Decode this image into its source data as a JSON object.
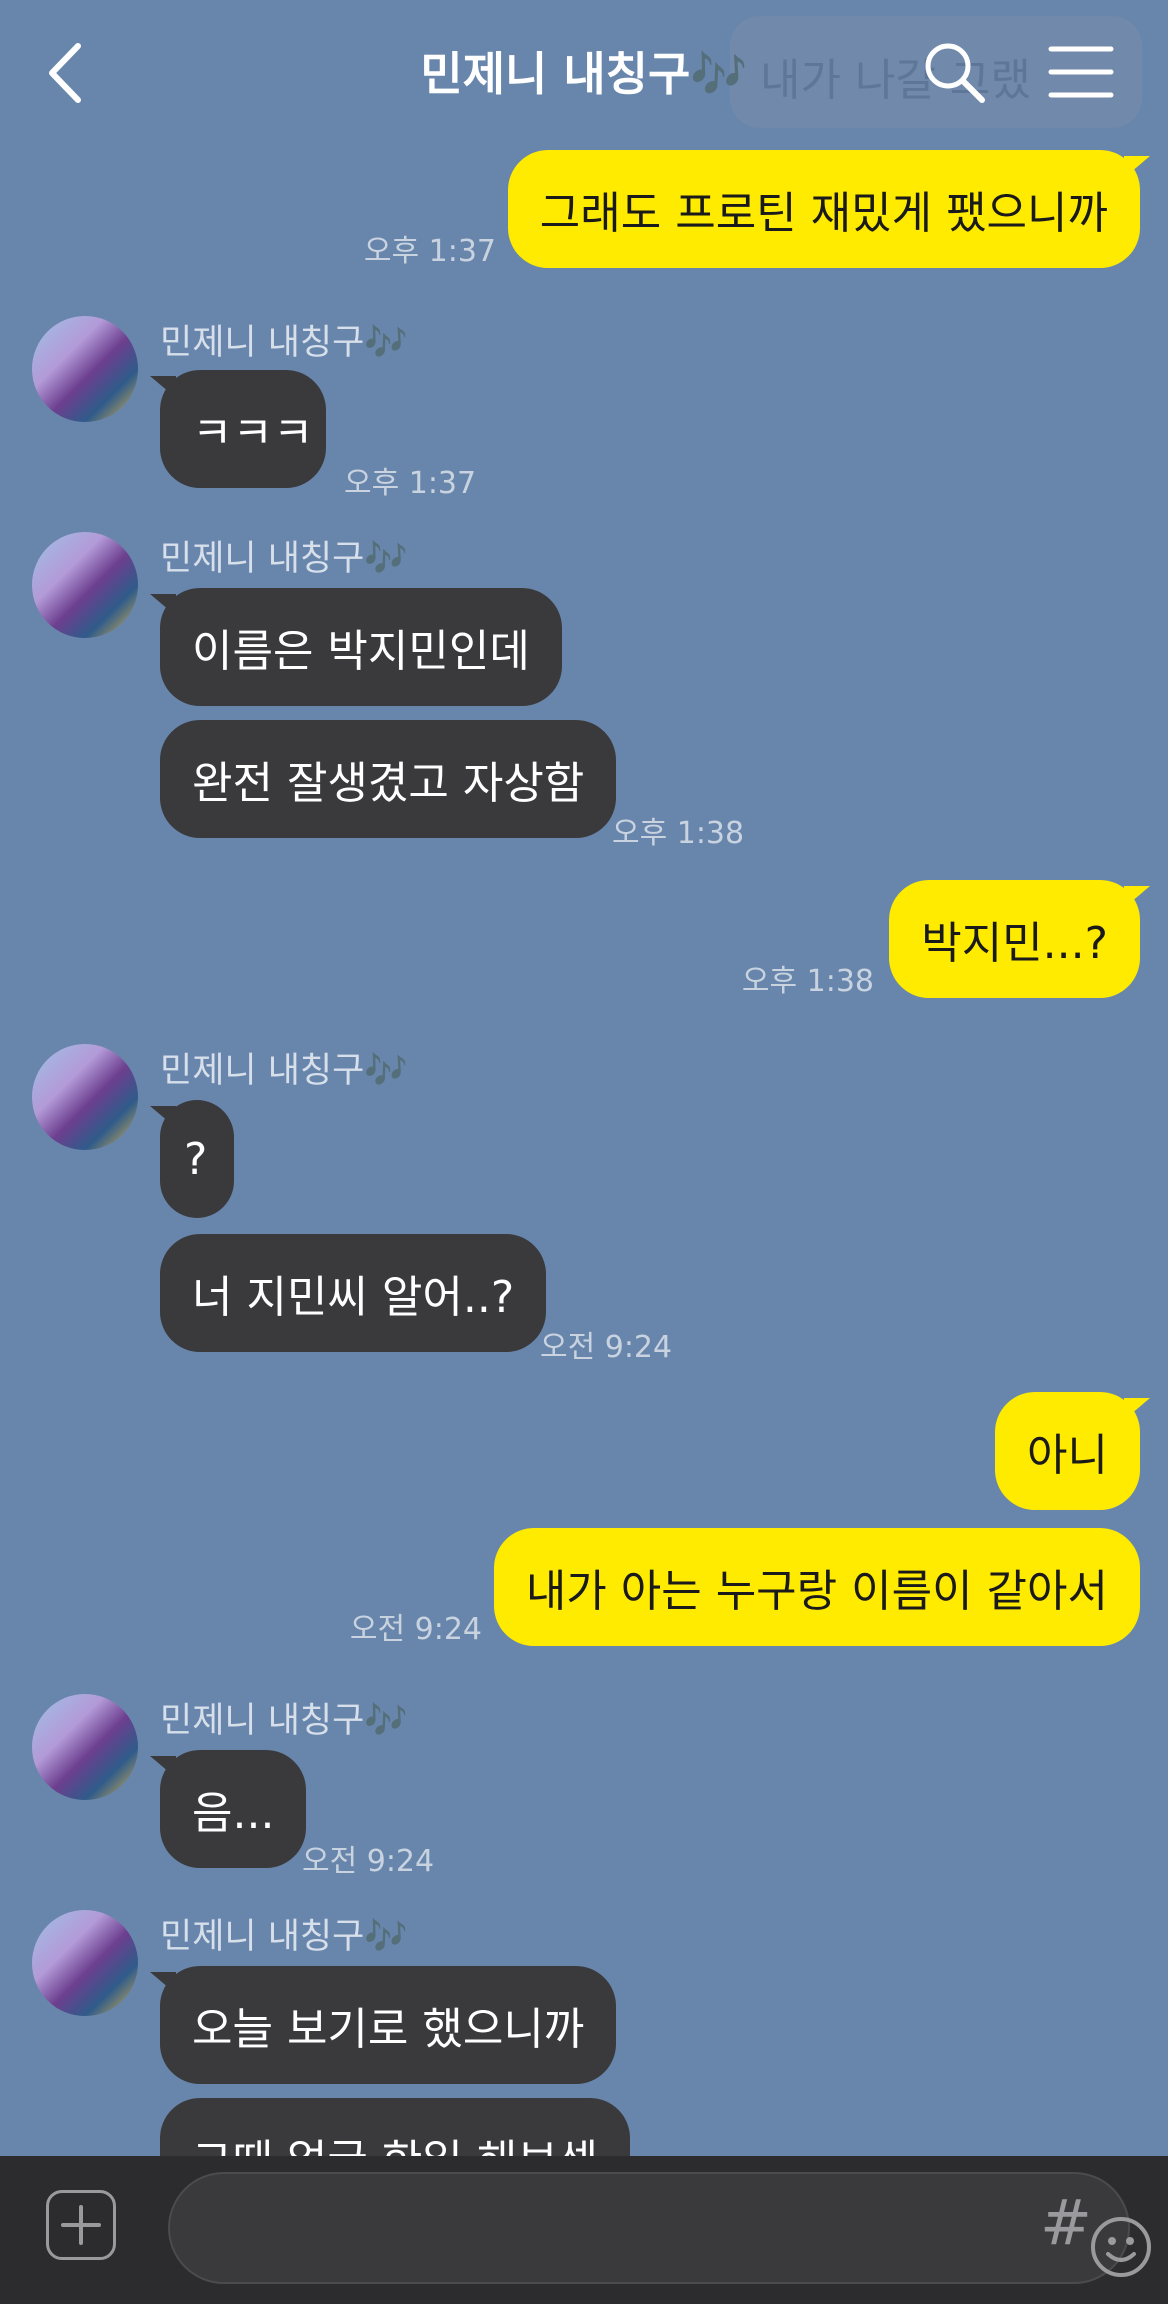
{
  "header": {
    "title": "민제니 내칭구🎶",
    "ghost_text": "내가 나갈 그랬",
    "back_icon": "chevron-left-icon",
    "search_icon": "search-icon",
    "menu_icon": "menu-icon"
  },
  "messages": [
    {
      "side": "mine",
      "text": "그래도 프로틴 재밌게 팼으니까",
      "time": "오후 1:37"
    },
    {
      "side": "theirs",
      "sender": "민제니 내칭구🎶",
      "text": "ㅋㅋㅋ",
      "time": "오후 1:37"
    },
    {
      "side": "theirs",
      "sender": "민제니 내칭구🎶",
      "text": "이름은 박지민인데"
    },
    {
      "side": "theirs",
      "text": "완전 잘생겼고 자상함",
      "time": "오후 1:38"
    },
    {
      "side": "mine",
      "text": "박지민...?",
      "time": "오후 1:38"
    },
    {
      "side": "theirs",
      "sender": "민제니 내칭구🎶",
      "text": "?"
    },
    {
      "side": "theirs",
      "text": "너 지민씨 알어..?",
      "time": "오전 9:24"
    },
    {
      "side": "mine",
      "text": "아니"
    },
    {
      "side": "mine",
      "text": "내가 아는 누구랑 이름이 같아서",
      "time": "오전 9:24"
    },
    {
      "side": "theirs",
      "sender": "민제니 내칭구🎶",
      "text": "음...",
      "time": "오전 9:24"
    },
    {
      "side": "theirs",
      "sender": "민제니 내칭구🎶",
      "text": "오늘 보기로 했으니까"
    },
    {
      "side": "theirs",
      "text": "그때 얼굴 한일 해보셈"
    }
  ],
  "input": {
    "placeholder": "",
    "plus_icon": "plus-icon",
    "emoji_icon": "emoji-icon",
    "hashtag_label": "#"
  },
  "colors": {
    "background": "#6886ac",
    "my_bubble": "#ffeb00",
    "their_bubble": "#3a3a3c",
    "bottom_bar": "#2c2c2e"
  }
}
